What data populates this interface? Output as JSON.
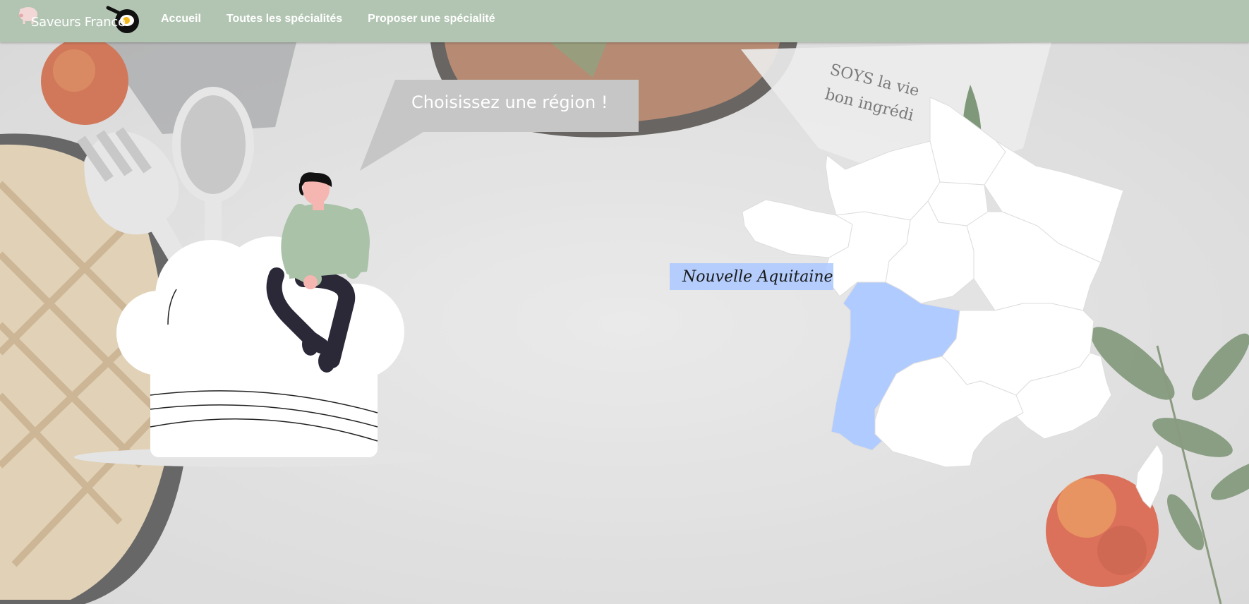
{
  "brand": {
    "name": "Saveurs France"
  },
  "nav": {
    "items": [
      {
        "label": "Accueil"
      },
      {
        "label": "Toutes les spécialités"
      },
      {
        "label": "Proposer une spécialité"
      }
    ]
  },
  "hero": {
    "speech": "Choisissez une région !"
  },
  "map": {
    "hovered_region": "Nouvelle Aquitaine",
    "highlight_color": "#b0cbff",
    "region_color": "#ffffff"
  },
  "colors": {
    "navbar": "#b2c5b2",
    "accent": "#b0cbff",
    "sweater": "#a9c2a8"
  }
}
